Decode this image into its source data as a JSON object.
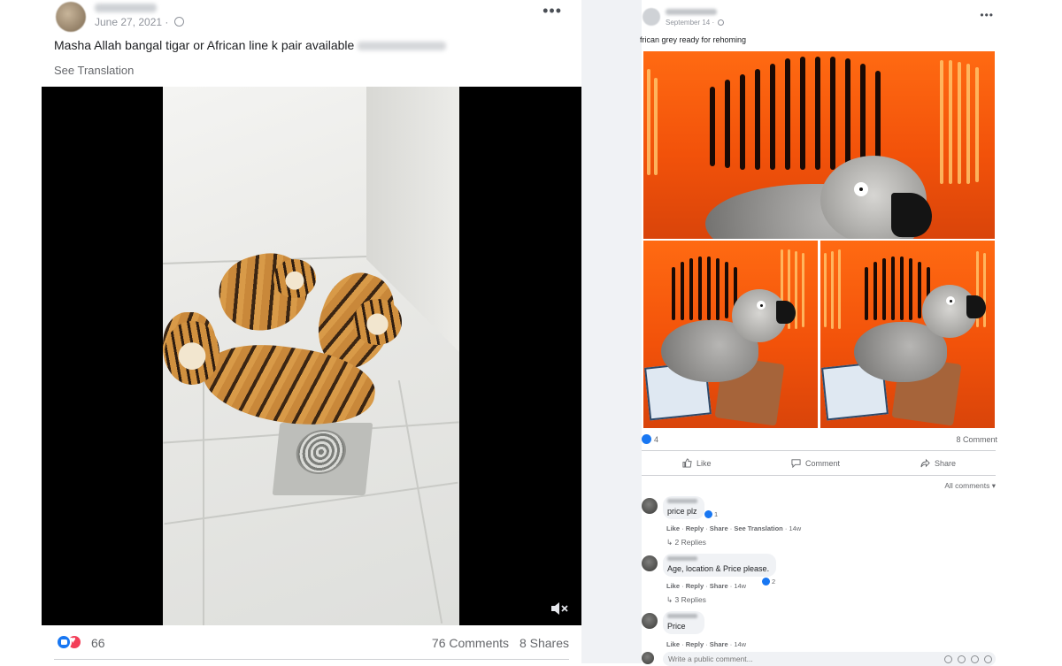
{
  "left_post": {
    "date": "June 27, 2021",
    "caption": "Masha Allah bangal tigar or African line k pair available",
    "see_translation": "See Translation",
    "reaction_count": "66",
    "comments": "76 Comments",
    "shares": "8 Shares",
    "icons": [
      "globe-icon",
      "more-options-icon",
      "mute-icon",
      "like-reaction-icon",
      "love-reaction-icon"
    ]
  },
  "right_post": {
    "date": "September 14",
    "caption": "frican grey ready for rehoming",
    "reaction_count": "4",
    "comments_count": "8 Comment",
    "actions": {
      "like": "Like",
      "comment": "Comment",
      "share": "Share"
    },
    "all_comments": "All comments",
    "comments": [
      {
        "text": "price plz",
        "reactions": "1",
        "actions": [
          "Like",
          "Reply",
          "Share",
          "See Translation"
        ],
        "time": "14w",
        "replies": "2 Replies"
      },
      {
        "text": "Age, location & Price please.",
        "reactions": "2",
        "actions": [
          "Like",
          "Reply",
          "Share"
        ],
        "time": "14w",
        "replies": "3 Replies"
      },
      {
        "text": "Price",
        "reactions": "",
        "actions": [
          "Like",
          "Reply",
          "Share"
        ],
        "time": "14w",
        "replies": ""
      }
    ],
    "write_placeholder": "Write a public comment..."
  },
  "colors": {
    "facebook_blue": "#1877f2",
    "love_red": "#f33e58",
    "crate_orange": "#f2520a",
    "muted_text": "#65676b"
  }
}
